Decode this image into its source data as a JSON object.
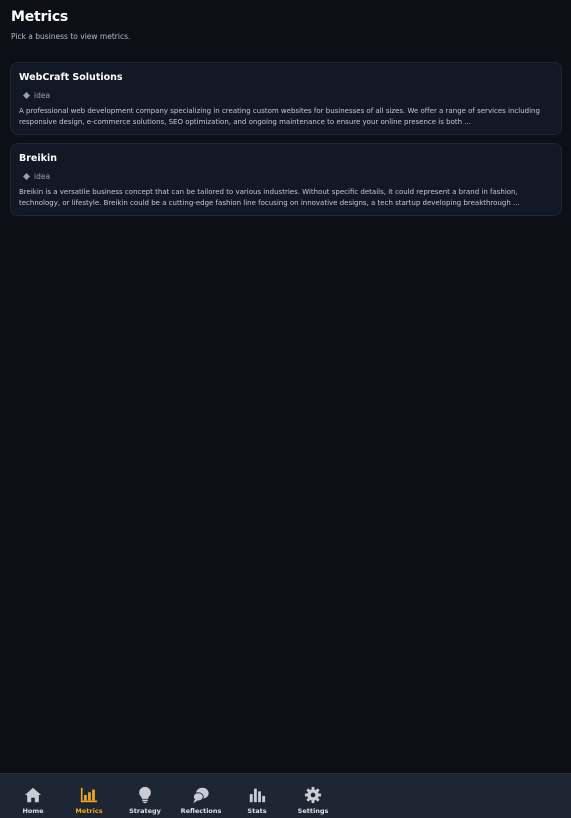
{
  "header": {
    "title": "Metrics",
    "subtitle": "Pick a business to view metrics."
  },
  "businesses": [
    {
      "name": "WebCraft Solutions",
      "tag": "idea",
      "description": "A professional web development company specializing in creating custom websites for businesses of all sizes. We offer a range of services including responsive design, e-commerce solutions, SEO optimization, and ongoing maintenance to ensure your online presence is both ..."
    },
    {
      "name": "Breikin",
      "tag": "idea",
      "description": "Breikin is a versatile business concept that can be tailored to various industries. Without specific details, it could represent a brand in fashion, technology, or lifestyle. Breikin could be a cutting-edge fashion line focusing on innovative designs, a tech startup developing breakthrough ..."
    }
  ],
  "nav": {
    "items": [
      {
        "label": "Home",
        "icon": "home-icon"
      },
      {
        "label": "Metrics",
        "icon": "bar-chart-icon",
        "active": true
      },
      {
        "label": "Strategy",
        "icon": "lightbulb-icon"
      },
      {
        "label": "Reflections",
        "icon": "chat-bubbles-icon"
      },
      {
        "label": "Stats",
        "icon": "stats-icon"
      },
      {
        "label": "Settings",
        "icon": "gear-icon"
      }
    ]
  },
  "colors": {
    "background": "#0c0f15",
    "card": "#121826",
    "nav": "#1e2533",
    "accent": "#f0a81e",
    "icon": "#c9ccd3"
  }
}
